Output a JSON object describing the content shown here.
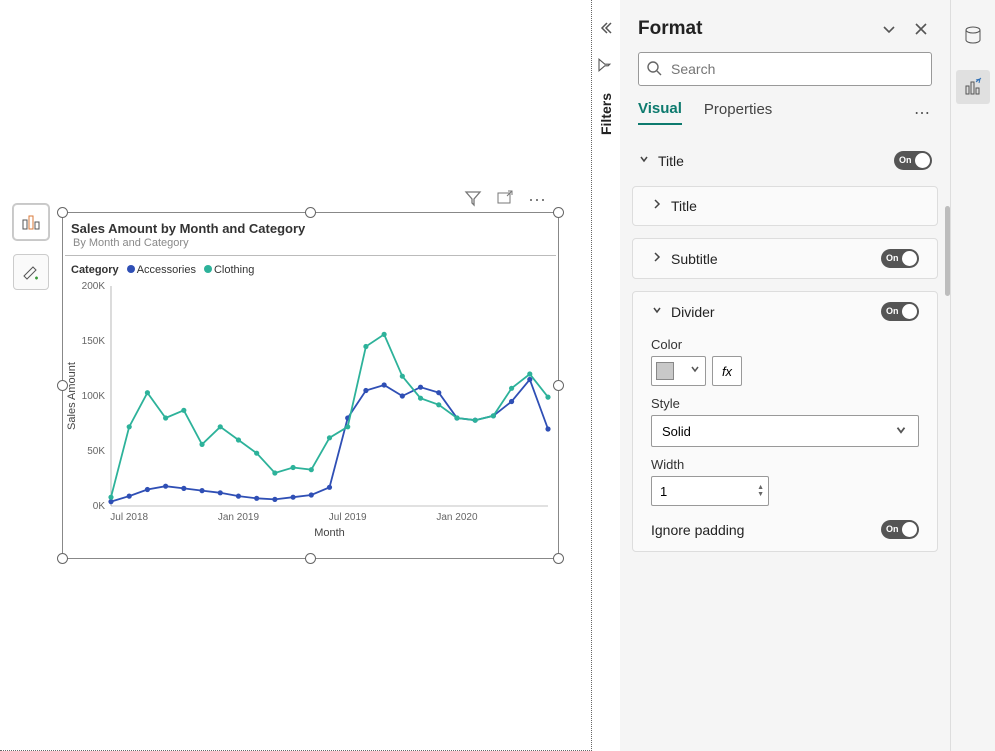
{
  "filters": {
    "label": "Filters"
  },
  "format_pane": {
    "title": "Format",
    "search_placeholder": "Search",
    "tabs": {
      "visual": "Visual",
      "properties": "Properties"
    },
    "sections": {
      "title_outer": "Title",
      "title_inner": "Title",
      "subtitle": "Subtitle",
      "divider": "Divider",
      "color_label": "Color",
      "style_label": "Style",
      "style_value": "Solid",
      "width_label": "Width",
      "width_value": "1",
      "ignore_padding": "Ignore padding",
      "fx": "fx",
      "on": "On"
    }
  },
  "divider_color": "#c8c8c8",
  "chart_data": {
    "type": "line",
    "title": "Sales Amount by Month and Category",
    "subtitle": "By Month and Category",
    "legend_title": "Category",
    "xlabel": "Month",
    "ylabel": "Sales Amount",
    "ylim": [
      0,
      200000
    ],
    "yticks": [
      "0K",
      "50K",
      "100K",
      "150K",
      "200K"
    ],
    "x": [
      "Jun 2018",
      "Jul 2018",
      "Aug 2018",
      "Sep 2018",
      "Oct 2018",
      "Nov 2018",
      "Dec 2018",
      "Jan 2019",
      "Feb 2019",
      "Mar 2019",
      "Apr 2019",
      "May 2019",
      "Jun 2019",
      "Jul 2019",
      "Aug 2019",
      "Sep 2019",
      "Oct 2019",
      "Nov 2019",
      "Dec 2019",
      "Jan 2020",
      "Feb 2020",
      "Mar 2020",
      "Apr 2020",
      "May 2020",
      "Jun 2020"
    ],
    "xticks_shown": [
      "Jul 2018",
      "Jan 2019",
      "Jul 2019",
      "Jan 2020"
    ],
    "series": [
      {
        "name": "Accessories",
        "color": "#2f4fb5",
        "values": [
          4000,
          9000,
          15000,
          18000,
          16000,
          14000,
          12000,
          9000,
          7000,
          6000,
          8000,
          10000,
          17000,
          80000,
          105000,
          110000,
          100000,
          108000,
          103000,
          80000,
          78000,
          82000,
          95000,
          115000,
          70000
        ]
      },
      {
        "name": "Clothing",
        "color": "#2db29a",
        "values": [
          8000,
          72000,
          103000,
          80000,
          87000,
          56000,
          72000,
          60000,
          48000,
          30000,
          35000,
          33000,
          62000,
          72000,
          145000,
          156000,
          118000,
          98000,
          92000,
          80000,
          78000,
          82000,
          107000,
          120000,
          99000
        ]
      }
    ]
  }
}
